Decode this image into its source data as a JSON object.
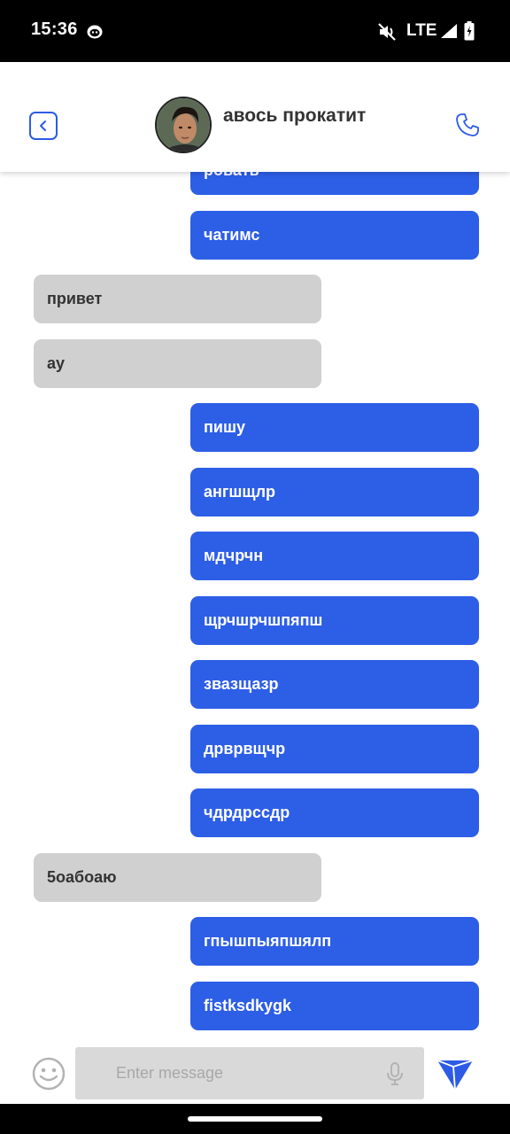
{
  "status_bar": {
    "time": "15:36",
    "network": "LTE",
    "icons": [
      "app-notification-icon",
      "mute-icon",
      "signal-icon",
      "battery-icon"
    ]
  },
  "header": {
    "contact_name": "авось прокатит",
    "icons": [
      "chevron-left-icon",
      "phone-icon"
    ],
    "accent_color": "#2d5be6"
  },
  "messages": [
    {
      "text": "ровать",
      "direction": "out"
    },
    {
      "text": "чатимс",
      "direction": "out"
    },
    {
      "text": "привет",
      "direction": "in"
    },
    {
      "text": "ау",
      "direction": "in"
    },
    {
      "text": "пишу",
      "direction": "out"
    },
    {
      "text": "ангшщлр",
      "direction": "out"
    },
    {
      "text": "мдчрчн",
      "direction": "out"
    },
    {
      "text": "щрчшрчшпяпш",
      "direction": "out"
    },
    {
      "text": "звазщазр",
      "direction": "out"
    },
    {
      "text": "дрврвщчр",
      "direction": "out"
    },
    {
      "text": "чдрдрссдр",
      "direction": "out"
    },
    {
      "text": "5оабоаю",
      "direction": "in"
    },
    {
      "text": "гпышпыяпшялп",
      "direction": "out"
    },
    {
      "text": "fistksdkygk",
      "direction": "out"
    }
  ],
  "composer": {
    "placeholder": "Enter message",
    "value": "",
    "icons": [
      "emoji-icon",
      "microphone-icon",
      "send-icon"
    ]
  },
  "colors": {
    "outgoing_bubble": "#2d5ee6",
    "incoming_bubble": "#d0d0d0"
  }
}
